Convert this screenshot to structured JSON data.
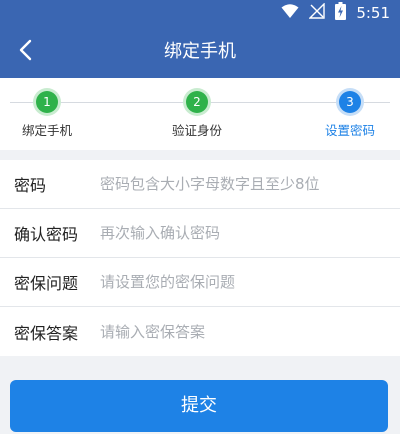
{
  "status_bar": {
    "time": "5:51",
    "icons": [
      "wifi-icon",
      "no-signal-icon",
      "battery-charging-icon"
    ]
  },
  "app_bar": {
    "back_icon": "chevron-left-icon",
    "title": "绑定手机"
  },
  "stepper": {
    "steps": [
      {
        "number": "1",
        "label": "绑定手机",
        "state": "done"
      },
      {
        "number": "2",
        "label": "验证身份",
        "state": "done"
      },
      {
        "number": "3",
        "label": "设置密码",
        "state": "active"
      }
    ]
  },
  "form": {
    "fields": [
      {
        "label": "密码",
        "value": "",
        "placeholder": "密码包含大小字母数字且至少8位"
      },
      {
        "label": "确认密码",
        "value": "",
        "placeholder": "再次输入确认密码"
      },
      {
        "label": "密保问题",
        "value": "",
        "placeholder": "请设置您的密保问题"
      },
      {
        "label": "密保答案",
        "value": "",
        "placeholder": "请输入密保答案"
      }
    ]
  },
  "submit": {
    "label": "提交"
  },
  "colors": {
    "primary": "#3a66b2",
    "accent": "#1e82e6",
    "done": "#2fb24a"
  }
}
